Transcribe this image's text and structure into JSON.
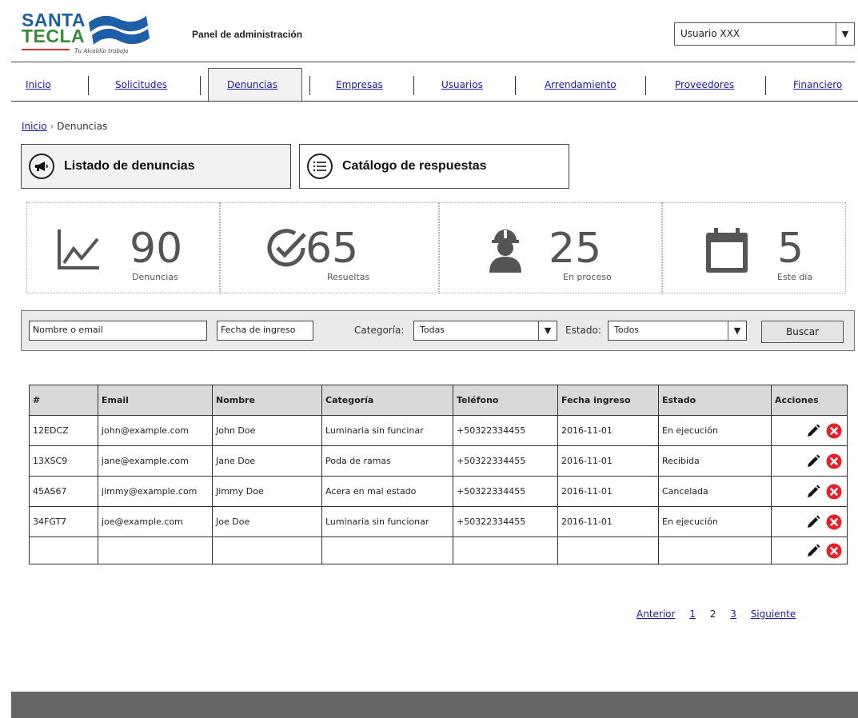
{
  "header": {
    "logo_line1": "SANTA",
    "logo_line2": "TECLA",
    "logo_tagline": "Tu Alcaldía trabaja",
    "title": "Panel de administración",
    "user_select": "Usuario XXX"
  },
  "nav": {
    "items": [
      {
        "label": "Inicio"
      },
      {
        "label": "Solicitudes"
      },
      {
        "label": "Denuncias",
        "active": true
      },
      {
        "label": "Empresas"
      },
      {
        "label": "Usuarios"
      },
      {
        "label": "Arrendamiento"
      },
      {
        "label": "Proveedores"
      },
      {
        "label": "Financiero"
      }
    ]
  },
  "breadcrumb": {
    "home": "Inicio",
    "sep": "›",
    "current": "Denuncias"
  },
  "tabs": {
    "listado": "Listado de denuncias",
    "catalogo": "Catálogo de respuestas"
  },
  "stats": [
    {
      "icon": "line-chart-icon",
      "value": "90",
      "caption": "Denuncias"
    },
    {
      "icon": "check-circle-icon",
      "value": "65",
      "caption": "Resueltas"
    },
    {
      "icon": "worker-icon",
      "value": "25",
      "caption": "En proceso"
    },
    {
      "icon": "calendar-icon",
      "value": "5",
      "caption": "Este día"
    }
  ],
  "filter": {
    "name_placeholder": "Nombre o email",
    "date_placeholder": "Fecha de ingreso",
    "category_label": "Categoría:",
    "category_value": "Todas",
    "state_label": "Estado:",
    "state_value": "Todos",
    "search_button": "Buscar"
  },
  "table": {
    "headers": [
      "#",
      "Email",
      "Nombre",
      "Categoría",
      "Teléfono",
      "Fecha ingreso",
      "Estado",
      "Acciones"
    ],
    "rows": [
      [
        "12EDCZ",
        "john@example.com",
        "John Doe",
        "Luminaria sin funcinar",
        "+50322334455",
        "2016-11-01",
        "En ejecución"
      ],
      [
        "13XSC9",
        "jane@example.com",
        "Jane Doe",
        "Poda de ramas",
        "+50322334455",
        "2016-11-01",
        "Recibida"
      ],
      [
        "45AS67",
        "jimmy@example.com",
        "Jimmy Doe",
        "Acera en mal estado",
        "+50322334455",
        "2016-11-01",
        "Cancelada"
      ],
      [
        "34FGT7",
        "joe@example.com",
        "Joe Doe",
        "Luminaria sin funcionar",
        "+50322334455",
        "2016-11-01",
        "En ejecución"
      ],
      [
        "",
        "",
        "",
        "",
        "",
        "",
        ""
      ]
    ]
  },
  "pager": {
    "prev": "Anterior",
    "pages": [
      "1",
      "2",
      "3"
    ],
    "current": "2",
    "next": "Siguiente"
  },
  "colors": {
    "delete": "#e8202a",
    "link": "#1a1aa6",
    "footer": "#666666"
  }
}
